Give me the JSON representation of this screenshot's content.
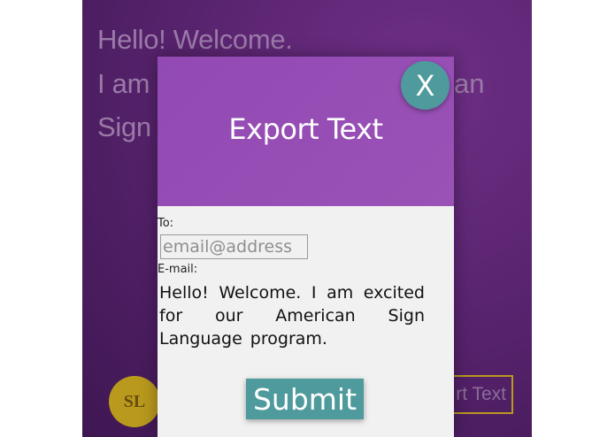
{
  "background": {
    "greeting_line_1": "Hello! Welcome.",
    "greeting_line_2": "I am",
    "greeting_line_2_tail": "an",
    "greeting_line_3": "Sign",
    "logo_text": "SL",
    "export_button_label": "rt Text"
  },
  "modal": {
    "title": "Export Text",
    "close_label": "X",
    "to_label": "To:",
    "email_placeholder": "email@address",
    "email_value": "",
    "email_label": "E-mail:",
    "message": "Hello!  Welcome.  I  am  excited for  our  American  Sign Language  program.",
    "submit_label": "Submit"
  },
  "colors": {
    "header_purple": "#9249b4",
    "accent_teal": "#4f9a9c",
    "background_purple": "#5a2470",
    "logo_gold": "#b99a1d"
  }
}
